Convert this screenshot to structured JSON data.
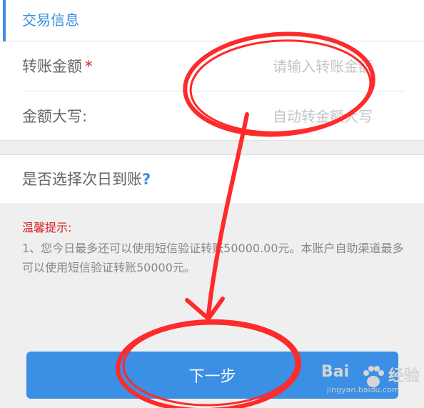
{
  "section": {
    "title": "交易信息"
  },
  "form": {
    "amount": {
      "label": "转账金额",
      "required_mark": "*",
      "placeholder": "请输入转账金额"
    },
    "amount_upper": {
      "label": "金额大写:",
      "placeholder": "自动转金额大写"
    }
  },
  "next_day": {
    "label": "是否选择次日到账",
    "help": "?"
  },
  "tips": {
    "title": "温馨提示:",
    "body": "1、您今日最多还可以使用短信验证转账50000.00元。本账户自助渠道最多可以使用短信验证转账50000元。"
  },
  "next_button": {
    "label": "下一步"
  },
  "annotation": {
    "color": "#ff2a2a"
  },
  "watermark": {
    "logo": "Bai",
    "logo_suffix": "经验",
    "url": "jingyan.baidu.com"
  },
  "colors": {
    "accent": "#3b8fe4",
    "required": "#e02020",
    "tip_title": "#d8232a"
  }
}
